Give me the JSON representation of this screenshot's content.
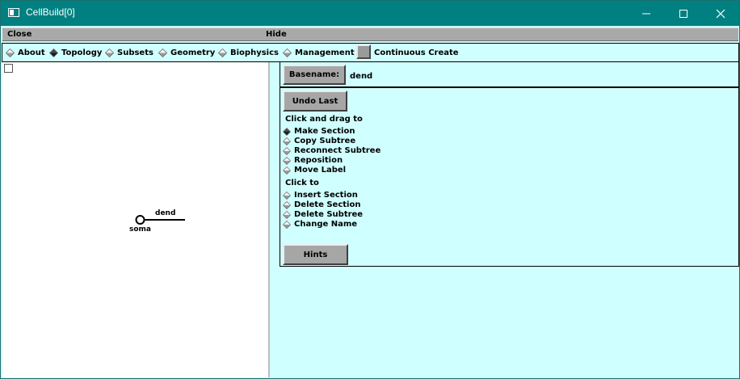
{
  "window": {
    "title": "CellBuild[0]"
  },
  "menubar": {
    "close_label": "Close",
    "hide_label": "Hide"
  },
  "tabs": [
    {
      "label": "About",
      "selected": false
    },
    {
      "label": "Topology",
      "selected": true
    },
    {
      "label": "Subsets",
      "selected": false
    },
    {
      "label": "Geometry",
      "selected": false
    },
    {
      "label": "Biophysics",
      "selected": false
    },
    {
      "label": "Management",
      "selected": false
    }
  ],
  "continuous_create_label": "Continuous Create",
  "canvas": {
    "dend_label": "dend",
    "soma_label": "soma"
  },
  "basename": {
    "button_label": "Basename:",
    "value": "dend"
  },
  "controls": {
    "undo_label": "Undo Last",
    "click_drag_heading": "Click and drag to",
    "drag_options": [
      {
        "label": "Make Section",
        "selected": true
      },
      {
        "label": "Copy Subtree",
        "selected": false
      },
      {
        "label": "Reconnect Subtree",
        "selected": false
      },
      {
        "label": "Reposition",
        "selected": false
      },
      {
        "label": "Move Label",
        "selected": false
      }
    ],
    "click_heading": "Click to",
    "click_options": [
      {
        "label": "Insert Section",
        "selected": false
      },
      {
        "label": "Delete Section",
        "selected": false
      },
      {
        "label": "Delete Subtree",
        "selected": false
      },
      {
        "label": "Change Name",
        "selected": false
      }
    ],
    "hints_label": "Hints"
  },
  "colors": {
    "panel_bg": "#d0ffff",
    "titlebar": "#008080",
    "button_face": "#a6a6a6"
  }
}
